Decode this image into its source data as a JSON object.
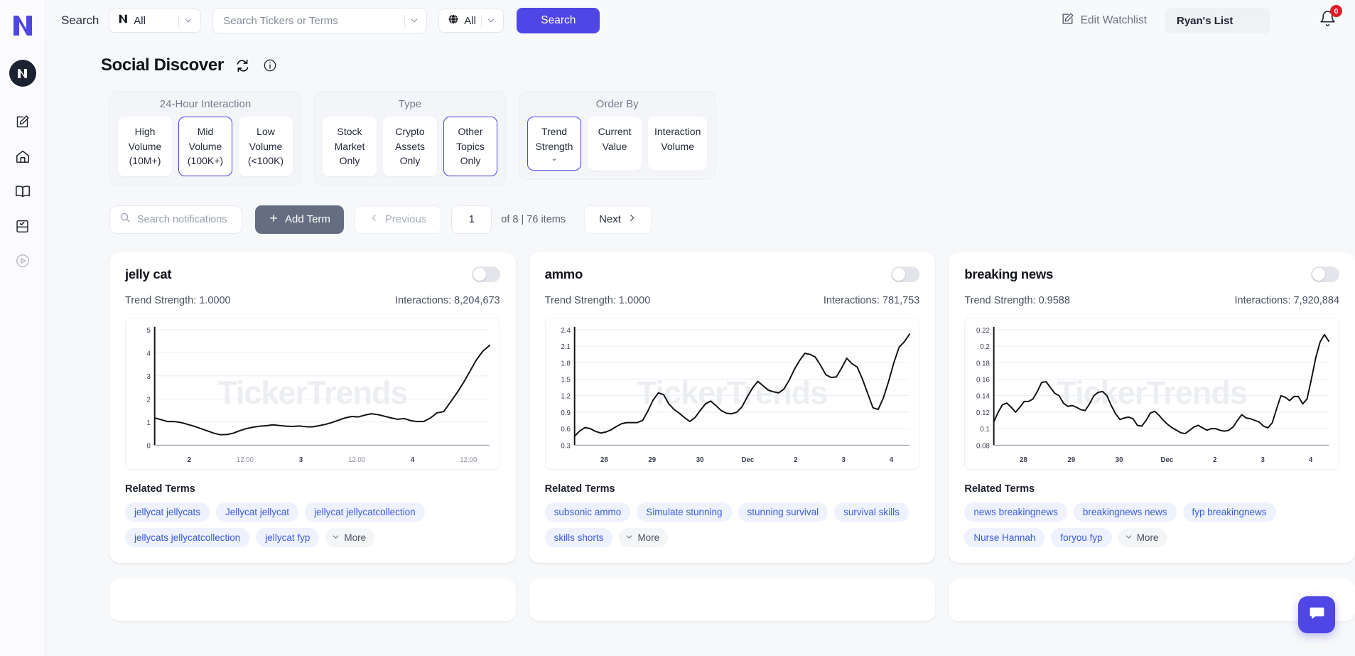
{
  "brand": {
    "logo_text": "N",
    "avatar_text": "N"
  },
  "sidebar": {
    "items": [
      {
        "name": "edit-icon",
        "label": "Edit"
      },
      {
        "name": "home-icon",
        "label": "Home"
      },
      {
        "name": "book-icon",
        "label": "Library"
      },
      {
        "name": "checklist-icon",
        "label": "Checklist"
      },
      {
        "name": "play-circle-icon",
        "label": "Play"
      }
    ]
  },
  "topbar": {
    "search_label": "Search",
    "ticker_select": {
      "value": "All",
      "icon": "n-logo-icon"
    },
    "search_input": {
      "value": "",
      "placeholder": "Search Tickers or Terms"
    },
    "region_select": {
      "value": "All",
      "icon": "globe-icon"
    },
    "search_button": "Search",
    "edit_watchlist": "Edit Watchlist",
    "watchlist_name": "Ryan's List",
    "notifications_count": "0"
  },
  "header": {
    "title": "Social Discover",
    "refresh_icon": "refresh-icon",
    "info_icon": "info-icon"
  },
  "filters": [
    {
      "title": "24-Hour Interaction",
      "options": [
        {
          "lines": [
            "High",
            "Volume",
            "(10M+)"
          ],
          "selected": false
        },
        {
          "lines": [
            "Mid",
            "Volume",
            "(100K+)"
          ],
          "selected": true
        },
        {
          "lines": [
            "Low",
            "Volume",
            "(<100K)"
          ],
          "selected": false
        }
      ]
    },
    {
      "title": "Type",
      "options": [
        {
          "lines": [
            "Stock",
            "Market",
            "Only"
          ],
          "selected": false
        },
        {
          "lines": [
            "Crypto",
            "Assets",
            "Only"
          ],
          "selected": false
        },
        {
          "lines": [
            "Other",
            "Topics",
            "Only"
          ],
          "selected": true
        }
      ]
    },
    {
      "title": "Order By",
      "options": [
        {
          "lines": [
            "Trend",
            "Strength"
          ],
          "selected": true,
          "chevron": "⌄"
        },
        {
          "lines": [
            "Current",
            "Value"
          ],
          "selected": false
        },
        {
          "lines": [
            "Interaction",
            "Volume"
          ],
          "selected": false
        }
      ]
    }
  ],
  "toolbar": {
    "search_placeholder": "Search notifications...",
    "search_value": "",
    "add_term_label": "Add Term",
    "add_term_icon": "plus-icon",
    "previous_label": "Previous",
    "page_value": "1",
    "page_count_text": "of 8 | 76 items",
    "next_label": "Next"
  },
  "cards": [
    {
      "title": "jelly cat",
      "trend_strength": "Trend Strength: 1.0000",
      "interactions": "Interactions: 8,204,673",
      "toggle_on": false,
      "watermark": "TickerTrends",
      "related_title": "Related Terms",
      "tags": [
        "jellycat jellycats",
        "Jellycat jellycat",
        "jellycat jellycatcollection",
        "jellycats jellycatcollection",
        "jellycat fyp"
      ],
      "more_label": "More"
    },
    {
      "title": "ammo",
      "trend_strength": "Trend Strength: 1.0000",
      "interactions": "Interactions: 781,753",
      "toggle_on": false,
      "watermark": "TickerTrends",
      "related_title": "Related Terms",
      "tags": [
        "subsonic ammo",
        "Simulate stunning",
        "stunning survival",
        "survival skills",
        "skills shorts"
      ],
      "more_label": "More"
    },
    {
      "title": "breaking news",
      "trend_strength": "Trend Strength: 0.9588",
      "interactions": "Interactions: 7,920,884",
      "toggle_on": false,
      "watermark": "TickerTrends",
      "related_title": "Related Terms",
      "tags": [
        "news breakingnews",
        "breakingnews news",
        "fyp breakingnews",
        "Nurse Hannah",
        "foryou fyp"
      ],
      "more_label": "More"
    }
  ],
  "chat": {
    "icon": "chat-bubble-icon"
  },
  "colors": {
    "accent": "#4f46e5",
    "tag_bg": "#eef2fe",
    "tag_text": "#3b5bdb",
    "badge_red": "#e01b24",
    "page_bg": "#f7f8fa"
  },
  "chart_data": [
    {
      "type": "line",
      "title": "jelly cat",
      "xlabel": "",
      "ylabel": "",
      "ylim": [
        0,
        5
      ],
      "yticks": [
        0,
        1,
        2,
        3,
        4,
        5
      ],
      "xticks": [
        "2",
        "12:00",
        "3",
        "12:00",
        "4",
        "12:00"
      ],
      "grid": true,
      "series": [
        {
          "name": "jelly cat",
          "values": [
            1.18,
            1.1,
            1.02,
            1.02,
            0.98,
            0.9,
            0.82,
            0.72,
            0.62,
            0.52,
            0.45,
            0.46,
            0.52,
            0.63,
            0.72,
            0.78,
            0.82,
            0.84,
            0.88,
            0.85,
            0.82,
            0.81,
            0.83,
            0.8,
            0.79,
            0.84,
            0.9,
            0.98,
            1.08,
            1.18,
            1.24,
            1.22,
            1.3,
            1.36,
            1.32,
            1.25,
            1.18,
            1.12,
            1.15,
            1.06,
            1.02,
            1.03,
            1.18,
            1.4,
            1.45,
            1.85,
            2.25,
            2.7,
            3.2,
            3.7,
            4.08,
            4.32
          ]
        }
      ]
    },
    {
      "type": "line",
      "title": "ammo",
      "xlabel": "",
      "ylabel": "",
      "ylim": [
        0.3,
        2.4
      ],
      "yticks": [
        0.3,
        0.6,
        0.9,
        1.2,
        1.5,
        1.8,
        2.1,
        2.4
      ],
      "xticks": [
        "28",
        "29",
        "30",
        "Dec",
        "2",
        "3",
        "4"
      ],
      "grid": true,
      "series": [
        {
          "name": "ammo",
          "values": [
            0.46,
            0.56,
            0.62,
            0.6,
            0.55,
            0.52,
            0.54,
            0.58,
            0.64,
            0.69,
            0.71,
            0.71,
            0.71,
            0.75,
            0.92,
            1.12,
            1.25,
            1.22,
            1.05,
            0.95,
            0.88,
            0.8,
            0.73,
            0.8,
            0.93,
            1.05,
            1.1,
            1.02,
            0.93,
            0.88,
            0.87,
            0.9,
            1.0,
            1.18,
            1.34,
            1.46,
            1.38,
            1.3,
            1.27,
            1.25,
            1.32,
            1.48,
            1.68,
            1.84,
            1.97,
            1.95,
            1.9,
            1.75,
            1.58,
            1.53,
            1.54,
            1.7,
            1.88,
            1.78,
            1.72,
            1.5,
            1.24,
            0.98,
            0.95,
            1.16,
            1.46,
            1.8,
            2.08,
            2.18,
            2.32
          ]
        }
      ]
    },
    {
      "type": "line",
      "title": "breaking news",
      "xlabel": "",
      "ylabel": "",
      "ylim": [
        0.08,
        0.22
      ],
      "yticks": [
        0.08,
        0.1,
        0.12,
        0.14,
        0.16,
        0.18,
        0.2,
        0.22
      ],
      "xticks": [
        "28",
        "29",
        "30",
        "Dec",
        "2",
        "3",
        "4"
      ],
      "grid": true,
      "series": [
        {
          "name": "breaking news",
          "values": [
            0.108,
            0.12,
            0.129,
            0.131,
            0.126,
            0.12,
            0.126,
            0.133,
            0.133,
            0.136,
            0.145,
            0.156,
            0.157,
            0.15,
            0.143,
            0.14,
            0.131,
            0.127,
            0.128,
            0.126,
            0.123,
            0.122,
            0.13,
            0.14,
            0.144,
            0.145,
            0.14,
            0.128,
            0.118,
            0.111,
            0.113,
            0.114,
            0.112,
            0.104,
            0.103,
            0.11,
            0.119,
            0.121,
            0.116,
            0.11,
            0.105,
            0.101,
            0.098,
            0.095,
            0.094,
            0.098,
            0.102,
            0.104,
            0.101,
            0.098,
            0.1,
            0.1,
            0.098,
            0.097,
            0.098,
            0.102,
            0.11,
            0.117,
            0.113,
            0.112,
            0.11,
            0.108,
            0.103,
            0.101,
            0.107,
            0.124,
            0.14,
            0.138,
            0.134,
            0.139,
            0.139,
            0.13,
            0.136,
            0.16,
            0.186,
            0.205,
            0.214,
            0.206
          ]
        }
      ]
    }
  ]
}
